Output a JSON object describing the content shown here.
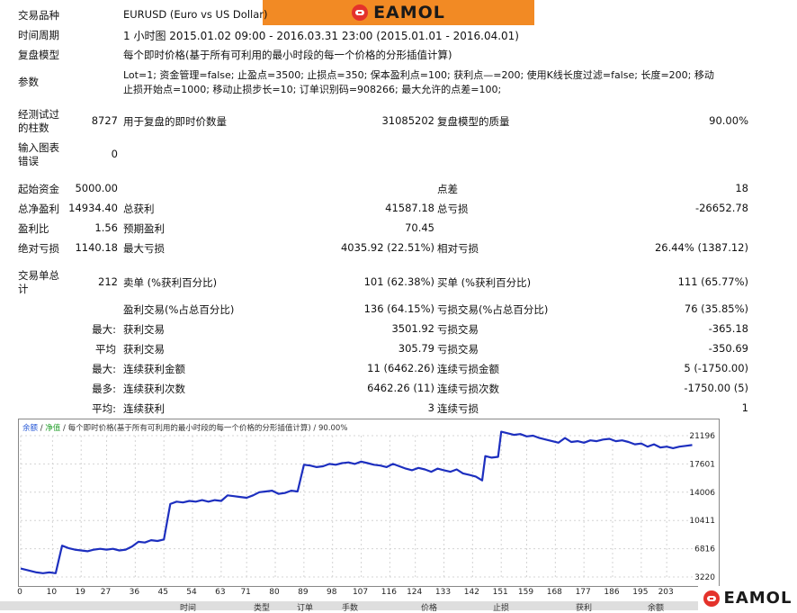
{
  "brand": {
    "logo_text": "EAMOL",
    "logo_icon": "robot-face-icon",
    "orange": "#f28a24",
    "red": "#e4322b"
  },
  "info": {
    "symbol_label": "交易品种",
    "symbol_value": "EURUSD (Euro vs US Dollar)",
    "period_label": "时间周期",
    "period_value": "1 小时图 2015.01.02 09:00 - 2016.03.31 23:00 (2015.01.01 - 2016.04.01)",
    "model_label": "复盘模型",
    "model_value": "每个即时价格(基于所有可利用的最小时段的每一个价格的分形插值计算)",
    "params_label": "参数",
    "params_line1": "Lot=1; 资金管理=false; 止盈点=3500; 止损点=350; 保本盈利点=100; 获利点—=200; 使用K线长度过滤=false; 长度=200; 移动",
    "params_line2": "止损开始点=1000; 移动止损步长=10; 订单识别码=908266; 最大允许的点差=100;"
  },
  "stats": {
    "bars_label_1": "经测试过",
    "bars_label_2": "的柱数",
    "bars_value": "8727",
    "ticks_label": "用于复盘的即时价数量",
    "ticks_value": "31085202",
    "quality_label": "复盘模型的质量",
    "quality_value": "90.00%",
    "errors_label_1": "输入图表",
    "errors_label_2": "错误",
    "errors_value": "0",
    "initial_deposit_label": "起始资金",
    "initial_deposit_value": "5000.00",
    "spread_label": "点差",
    "spread_value": "18",
    "net_profit_label": "总净盈利",
    "net_profit_value": "14934.40",
    "gross_profit_label": "总获利",
    "gross_profit_value": "41587.18",
    "gross_loss_label": "总亏损",
    "gross_loss_value": "-26652.78",
    "profit_factor_label": "盈利比",
    "profit_factor_value": "1.56",
    "expected_payoff_label": "预期盈利",
    "expected_payoff_value": "70.45",
    "abs_drawdown_label": "绝对亏损",
    "abs_drawdown_value": "1140.18",
    "max_drawdown_label": "最大亏损",
    "max_drawdown_value": "4035.92 (22.51%)",
    "rel_drawdown_label": "相对亏损",
    "rel_drawdown_value": "26.44% (1387.12)",
    "total_trades_label_1": "交易单总",
    "total_trades_label_2": "计",
    "total_trades_value": "212",
    "short_label": "卖单 (%获利百分比)",
    "short_value": "101 (62.38%)",
    "long_label": "买单 (%获利百分比)",
    "long_value": "111 (65.77%)",
    "profit_trades_label": "盈利交易(%占总百分比)",
    "profit_trades_value": "136 (64.15%)",
    "loss_trades_label": "亏损交易(%占总百分比)",
    "loss_trades_value": "76 (35.85%)",
    "largest_prefix": "最大:",
    "largest_profit_label": "获利交易",
    "largest_profit_value": "3501.92",
    "largest_loss_label": "亏损交易",
    "largest_loss_value": "-365.18",
    "average_prefix": "平均",
    "average_profit_label": "获利交易",
    "average_profit_value": "305.79",
    "average_loss_label": "亏损交易",
    "average_loss_value": "-350.69",
    "max_prefix": "最大:",
    "max_consec_wins_label": "连续获利金额",
    "max_consec_wins_value": "11 (6462.26)",
    "max_consec_losses_label": "连续亏损金额",
    "max_consec_losses_value": "5 (-1750.00)",
    "most_prefix": "最多:",
    "max_consec_profit_label": "连续获利次数",
    "max_consec_profit_value": "6462.26 (11)",
    "max_consec_loss_label": "连续亏损次数",
    "max_consec_loss_value": "-1750.00 (5)",
    "avg_consec_prefix": "平均:",
    "avg_consec_wins_label": "连续获利",
    "avg_consec_wins_value": "3",
    "avg_consec_losses_label": "连续亏损",
    "avg_consec_losses_value": "1"
  },
  "chart_legend": {
    "balance": "余额",
    "sep1": " / ",
    "equity": "净值",
    "sep2": " / ",
    "rest": "每个即时价格(基于所有可利用的最小时段的每一个价格的分形插值计算) / 90.00%"
  },
  "chart_data": {
    "type": "line",
    "x_ticks": [
      "0",
      "10",
      "19",
      "27",
      "36",
      "45",
      "54",
      "63",
      "71",
      "80",
      "89",
      "98",
      "107",
      "116",
      "124",
      "133",
      "142",
      "151",
      "159",
      "168",
      "177",
      "186",
      "195",
      "203"
    ],
    "y_ticks": [
      "21196",
      "17601",
      "14006",
      "10411",
      "6816",
      "3220"
    ],
    "ylim": [
      3220,
      21196
    ],
    "xlim": [
      0,
      212
    ],
    "series": [
      {
        "color": "#1d2fbf",
        "points": [
          [
            0,
            4300
          ],
          [
            3,
            4000
          ],
          [
            5,
            3800
          ],
          [
            7,
            3700
          ],
          [
            9,
            3800
          ],
          [
            11,
            3700
          ],
          [
            13,
            7200
          ],
          [
            15,
            6900
          ],
          [
            17,
            6700
          ],
          [
            19,
            6600
          ],
          [
            21,
            6500
          ],
          [
            23,
            6700
          ],
          [
            25,
            6800
          ],
          [
            27,
            6700
          ],
          [
            29,
            6800
          ],
          [
            31,
            6600
          ],
          [
            33,
            6700
          ],
          [
            35,
            7100
          ],
          [
            37,
            7700
          ],
          [
            39,
            7600
          ],
          [
            41,
            7900
          ],
          [
            43,
            7800
          ],
          [
            45,
            8000
          ],
          [
            47,
            12500
          ],
          [
            49,
            12800
          ],
          [
            51,
            12700
          ],
          [
            53,
            12900
          ],
          [
            55,
            12800
          ],
          [
            57,
            13000
          ],
          [
            59,
            12800
          ],
          [
            61,
            13000
          ],
          [
            63,
            12900
          ],
          [
            65,
            13600
          ],
          [
            67,
            13500
          ],
          [
            69,
            13400
          ],
          [
            71,
            13300
          ],
          [
            73,
            13600
          ],
          [
            75,
            14000
          ],
          [
            77,
            14100
          ],
          [
            79,
            14200
          ],
          [
            81,
            13800
          ],
          [
            83,
            13900
          ],
          [
            85,
            14200
          ],
          [
            87,
            14100
          ],
          [
            89,
            17500
          ],
          [
            91,
            17400
          ],
          [
            93,
            17200
          ],
          [
            95,
            17300
          ],
          [
            97,
            17600
          ],
          [
            99,
            17500
          ],
          [
            101,
            17700
          ],
          [
            103,
            17800
          ],
          [
            105,
            17600
          ],
          [
            107,
            17900
          ],
          [
            109,
            17700
          ],
          [
            111,
            17500
          ],
          [
            113,
            17400
          ],
          [
            115,
            17200
          ],
          [
            117,
            17600
          ],
          [
            119,
            17300
          ],
          [
            121,
            17000
          ],
          [
            123,
            16800
          ],
          [
            125,
            17100
          ],
          [
            127,
            16900
          ],
          [
            129,
            16600
          ],
          [
            131,
            17000
          ],
          [
            133,
            16800
          ],
          [
            135,
            16600
          ],
          [
            137,
            16900
          ],
          [
            139,
            16400
          ],
          [
            141,
            16200
          ],
          [
            143,
            16000
          ],
          [
            145,
            15500
          ],
          [
            146,
            18600
          ],
          [
            148,
            18400
          ],
          [
            150,
            18500
          ],
          [
            151,
            21700
          ],
          [
            153,
            21500
          ],
          [
            155,
            21300
          ],
          [
            157,
            21400
          ],
          [
            159,
            21100
          ],
          [
            161,
            21200
          ],
          [
            163,
            20900
          ],
          [
            165,
            20700
          ],
          [
            167,
            20500
          ],
          [
            169,
            20300
          ],
          [
            171,
            20900
          ],
          [
            173,
            20400
          ],
          [
            175,
            20500
          ],
          [
            177,
            20300
          ],
          [
            179,
            20600
          ],
          [
            181,
            20500
          ],
          [
            183,
            20700
          ],
          [
            185,
            20800
          ],
          [
            187,
            20500
          ],
          [
            189,
            20600
          ],
          [
            191,
            20400
          ],
          [
            193,
            20100
          ],
          [
            195,
            20200
          ],
          [
            197,
            19800
          ],
          [
            199,
            20100
          ],
          [
            201,
            19700
          ],
          [
            203,
            19800
          ],
          [
            205,
            19600
          ],
          [
            207,
            19800
          ],
          [
            209,
            19900
          ],
          [
            211,
            20000
          ]
        ]
      }
    ]
  },
  "table_header": {
    "col_type": "类型",
    "col_time": "时间",
    "col_order": "订单",
    "col_lots": "手数",
    "col_price": "价格",
    "col_sl": "止损",
    "col_profit": "获利",
    "col_balance": "余额"
  }
}
